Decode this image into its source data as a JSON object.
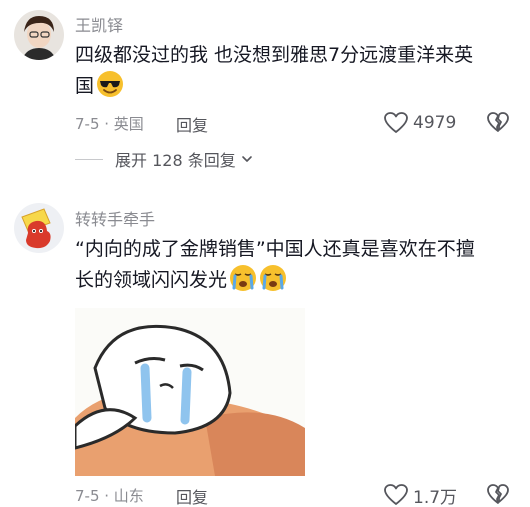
{
  "comments": [
    {
      "username": "王凯铎",
      "text_line1": "四级都没过的我 也没想到雅思7分远渡重洋来英",
      "text_line2": "国",
      "date_location": "7-5 · 英国",
      "reply_label": "回复",
      "like_count": "4979",
      "emoji": "cool-sunglasses-emoji"
    },
    {
      "username": "转转手牵手",
      "text_line1": "“内向的成了金牌销售”中国人还真是喜欢在不擅",
      "text_line2": "长的领域闪闪发光",
      "date_location": "7-5 · 山东",
      "reply_label": "回复",
      "like_count": "1.7万",
      "emoji": "crying-emoji"
    }
  ],
  "expand_replies": {
    "label": "展开 128 条回复"
  },
  "colors": {
    "text_primary": "#161823",
    "text_secondary": "#8a8b91",
    "accent_emoji": "#f7c02d"
  }
}
